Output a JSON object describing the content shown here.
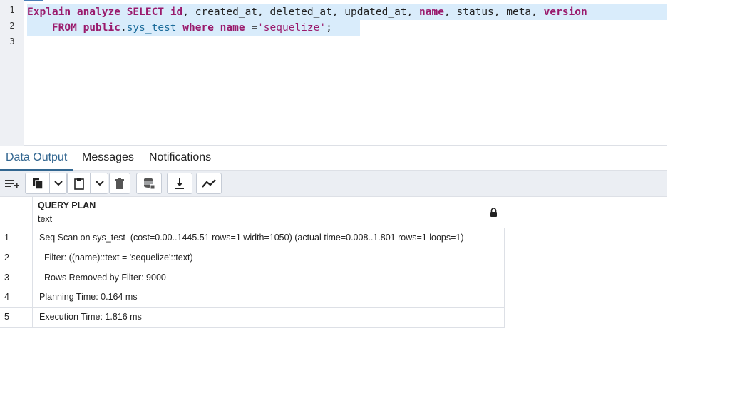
{
  "editor": {
    "line_numbers": [
      "1",
      "2",
      "3"
    ],
    "line1": {
      "kw1": "Explain",
      "kw2": "analyze",
      "kw3": "SELECT",
      "kw4": "id",
      "plain1": ", created_at, deleted_at, updated_at, ",
      "kw5": "name",
      "plain2": ", status, meta, ",
      "kw6": "version"
    },
    "line2": {
      "indent": "    ",
      "kw1": "FROM",
      "kw2": "public",
      "dot": ".",
      "table": "sys_test",
      "kw3": "where",
      "kw4": "name",
      "op": " =",
      "str": "'sequelize'",
      "end": ";"
    }
  },
  "tabs": [
    {
      "label": "Data Output"
    },
    {
      "label": "Messages"
    },
    {
      "label": "Notifications"
    }
  ],
  "toolbar": {
    "icons": [
      "add-row-icon",
      "copy-icon",
      "chevron-down-icon",
      "paste-icon",
      "chevron-down-icon",
      "delete-icon",
      "save-data-icon",
      "download-icon",
      "graph-icon"
    ]
  },
  "grid": {
    "column": {
      "name": "QUERY PLAN",
      "type": "text"
    },
    "rows": [
      {
        "num": "1",
        "value": "Seq Scan on sys_test  (cost=0.00..1445.51 rows=1 width=1050) (actual time=0.008..1.801 rows=1 loops=1)"
      },
      {
        "num": "2",
        "value": "  Filter: ((name)::text = 'sequelize'::text)"
      },
      {
        "num": "3",
        "value": "  Rows Removed by Filter: 9000"
      },
      {
        "num": "4",
        "value": "Planning Time: 0.164 ms"
      },
      {
        "num": "5",
        "value": "Execution Time: 1.816 ms"
      }
    ]
  },
  "colors": {
    "keyword": "#9a1a6c",
    "table": "#1a6b9a",
    "active_tab": "#326690",
    "selection": "#d9ecfb"
  }
}
